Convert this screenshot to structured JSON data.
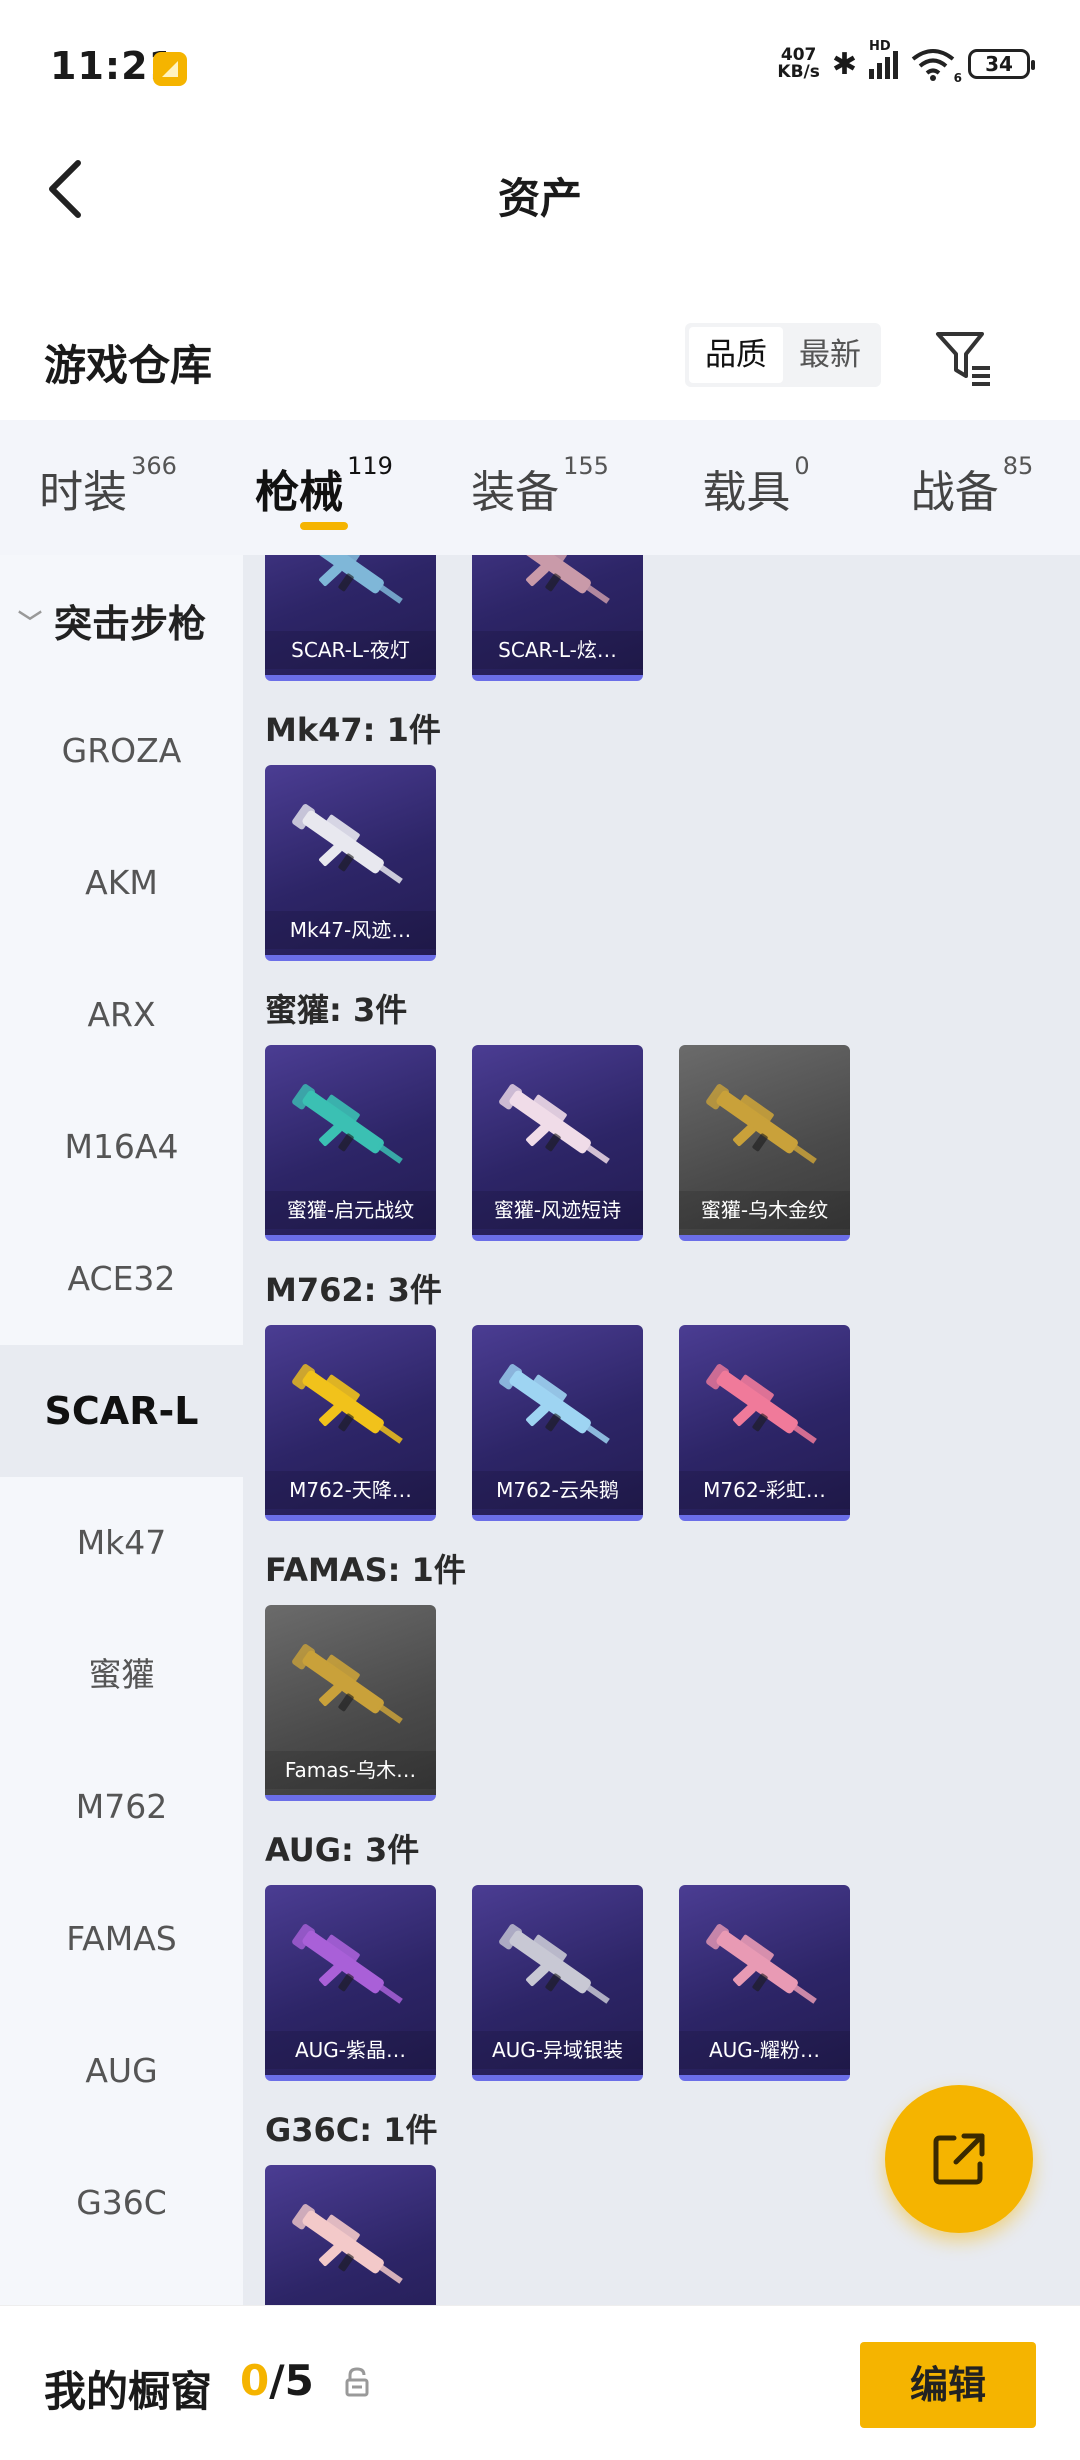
{
  "status": {
    "time": "11:21",
    "speed_top": "407",
    "speed_bottom": "KB/s",
    "signal_label": "HD",
    "wifi_sub": "6",
    "battery": "34"
  },
  "nav": {
    "title": "资产"
  },
  "warehouse": {
    "title": "游戏仓库",
    "sort_options": [
      "品质",
      "最新"
    ],
    "active_sort": "品质"
  },
  "tabs": [
    {
      "label": "时装",
      "count": "366"
    },
    {
      "label": "枪械",
      "count": "119"
    },
    {
      "label": "装备",
      "count": "155"
    },
    {
      "label": "载具",
      "count": "0"
    },
    {
      "label": "战备",
      "count": "85"
    }
  ],
  "sidebar": {
    "group": "突击步枪",
    "items": [
      "GROZA",
      "AKM",
      "ARX",
      "M16A4",
      "ACE32",
      "SCAR-L",
      "Mk47",
      "蜜獾",
      "M762",
      "FAMAS",
      "AUG",
      "G36C"
    ],
    "active": "SCAR-L"
  },
  "sections": [
    {
      "title": "",
      "cards": [
        {
          "name": "SCAR-L-夜灯",
          "style": "purple",
          "color": "#7fb7d8"
        },
        {
          "name": "SCAR-L-炫…",
          "style": "purple",
          "color": "#c99aa9"
        }
      ]
    },
    {
      "title": "Mk47: 1件",
      "cards": [
        {
          "name": "Mk47-风迹…",
          "style": "purple",
          "color": "#e8e8ef"
        }
      ]
    },
    {
      "title": "蜜獾: 3件",
      "cards": [
        {
          "name": "蜜獾-启元战纹",
          "style": "purple",
          "color": "#3bc0b3"
        },
        {
          "name": "蜜獾-风迹短诗",
          "style": "purple",
          "color": "#f0dce8"
        },
        {
          "name": "蜜獾-乌木金纹",
          "style": "grey",
          "color": "#c9a13a"
        }
      ]
    },
    {
      "title": "M762: 3件",
      "cards": [
        {
          "name": "M762-天降…",
          "style": "purple",
          "color": "#f1c21b"
        },
        {
          "name": "M762-云朵鹅",
          "style": "purple",
          "color": "#9ed4f2"
        },
        {
          "name": "M762-彩虹…",
          "style": "purple",
          "color": "#f07a9a"
        }
      ]
    },
    {
      "title": "FAMAS: 1件",
      "cards": [
        {
          "name": "Famas-乌木…",
          "style": "grey",
          "color": "#c9a13a"
        }
      ]
    },
    {
      "title": "AUG: 3件",
      "cards": [
        {
          "name": "AUG-紫晶…",
          "style": "purple",
          "color": "#a960d8"
        },
        {
          "name": "AUG-异域银装",
          "style": "purple",
          "color": "#c8c8d4"
        },
        {
          "name": "AUG-耀粉…",
          "style": "purple",
          "color": "#e89ab4"
        }
      ]
    },
    {
      "title": "G36C: 1件",
      "cards": [
        {
          "name": "",
          "style": "purple",
          "color": "#f3c9c9"
        }
      ]
    }
  ],
  "bottom": {
    "title": "我的橱窗",
    "count_current": "0",
    "count_total": "/5",
    "edit_label": "编辑"
  },
  "colors": {
    "accent": "#f5b400",
    "card_purple": "#2d2567",
    "card_bar": "#6b6ee8"
  },
  "icons": {
    "back": "chevron-left-icon",
    "filter": "filter-icon",
    "fab": "share-external-icon",
    "lock": "lock-icon"
  }
}
